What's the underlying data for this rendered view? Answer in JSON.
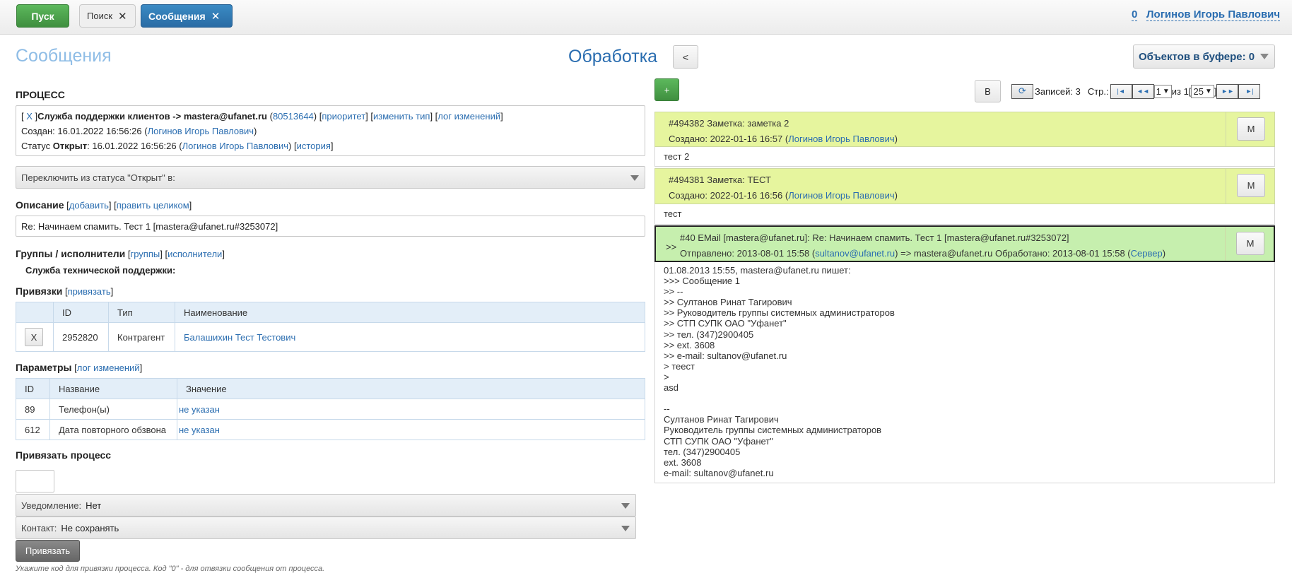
{
  "topbar": {
    "start_label": "Пуск",
    "tabs": [
      {
        "label": "Поиск",
        "close": "✕"
      },
      {
        "label": "Сообщения",
        "close": "✕"
      }
    ],
    "count": "0",
    "user": "Логинов Игорь Павлович"
  },
  "header": {
    "messages_title": "Сообщения",
    "processing_title": "Обработка",
    "back_label": "<",
    "buffer_label": "Объектов в буфере: 0"
  },
  "process": {
    "section_title": "ПРОЦЕСС",
    "line1": {
      "open": "[ ",
      "x": "X",
      "close": " ]",
      "name": "Служба поддержки клиентов -> mastera@ufanet.ru",
      "id_open": " (",
      "id": "80513644",
      "id_close": ") [",
      "priority": "приоритет",
      "sep1": "] [",
      "change_type": "изменить тип",
      "sep2": "] [",
      "change_log": "лог изменений",
      "end": "]"
    },
    "line2": {
      "prefix": "Создан: 16.01.2022 16:56:26 (",
      "user": "Логинов Игорь Павлович",
      "suffix": ")"
    },
    "line3": {
      "prefix": "Статус ",
      "status": "Открыт",
      "mid": ": 16.01.2022 16:56:26 (",
      "user": "Логинов Игорь Павлович",
      "mid2": ") [",
      "history": "история",
      "end": "]"
    },
    "switch_status": "Переключить из статуса \"Открыт\" в:"
  },
  "description": {
    "title": "Описание",
    "open1": " [",
    "add": "добавить",
    "sep": "] [",
    "edit_all": "править целиком",
    "end": "]",
    "value": "Re: Начинаем спамить. Тест 1 [mastera@ufanet.ru#3253072]"
  },
  "groups": {
    "title": "Группы / исполнители",
    "open1": " [",
    "groups_link": "группы",
    "sep": "] [",
    "executors_link": "исполнители",
    "end": "]",
    "group_name": "Служба технической поддержки:"
  },
  "links": {
    "title": "Привязки",
    "open1": " [",
    "bind_link": "привязать",
    "end": "]",
    "columns": [
      "",
      "ID",
      "Тип",
      "Наименование"
    ],
    "rows": [
      {
        "btn": "X",
        "id": "2952820",
        "type": "Контрагент",
        "name": "Балашихин Тест Тестович"
      }
    ]
  },
  "params": {
    "title": "Параметры",
    "open1": " [",
    "log_link": "лог изменений",
    "end": "]",
    "columns": [
      "ID",
      "Название",
      "Значение"
    ],
    "rows": [
      {
        "id": "89",
        "name": "Телефон(ы)",
        "value": "не указан"
      },
      {
        "id": "612",
        "name": "Дата повторного обзвона",
        "value": "не указан"
      }
    ]
  },
  "bind_process": {
    "title": "Привязать процесс",
    "notify_label": "Уведомление:",
    "notify_value": "Нет",
    "contact_label": "Контакт:",
    "contact_value": "Не сохранять",
    "bind_button": "Привязать",
    "hint": "Укажите код для привязки процесса. Код \"0\" - для отвязки сообщения от процесса."
  },
  "right_toolbar": {
    "plus_label": "+",
    "b_label": "B",
    "records_label": "Записей: 3",
    "page_label": "Стр.:",
    "page_value": "1",
    "of_label": "из 1",
    "page_size": "25",
    "bracket_open": "[",
    "bracket_close": "]",
    "first_icon": "|◄",
    "prev_icon": "◄◄",
    "next_icon": "►►",
    "last_icon": "►|",
    "refresh_icon": "⟳"
  },
  "messages": [
    {
      "title": "#494382 Заметка: заметка 2",
      "created_prefix": "Создано: 2022-01-16 16:57 (",
      "created_user": "Логинов Игорь Павлович",
      "created_suffix": ")",
      "m_label": "M",
      "body": "тест 2"
    },
    {
      "title": "#494381 Заметка: ТЕСТ",
      "created_prefix": "Создано: 2022-01-16 16:56 (",
      "created_user": "Логинов Игорь Павлович",
      "created_suffix": ")",
      "m_label": "M",
      "body": "тест"
    }
  ],
  "email": {
    "arrow": ">>",
    "title": "#40 EMail [mastera@ufanet.ru]: Re: Начинаем спамить. Тест 1 [mastera@ufanet.ru#3253072]",
    "sent_prefix": "Отправлено: 2013-08-01 15:58 (",
    "sent_from": "sultanov@ufanet.ru",
    "sent_mid": ") => mastera@ufanet.ru Обработано: 2013-08-01 15:58 (",
    "server": "Сервер",
    "sent_end": ")",
    "m_label": "M",
    "body_lines": [
      "01.08.2013 15:55, mastera@ufanet.ru пишет:",
      ">>> Сообщение 1",
      ">> --",
      ">> Султанов Ринат Тагирович",
      ">> Руководитель группы системных администраторов",
      ">> СТП СУПК ОАО \"Уфанет\"",
      ">> тел. (347)2900405",
      ">> ext. 3608",
      ">> e-mail: sultanov@ufanet.ru",
      "> теест",
      ">",
      "asd",
      " ",
      "--",
      "Султанов Ринат Тагирович",
      "Руководитель группы системных администраторов",
      "СТП СУПК ОАО \"Уфанет\"",
      "тел. (347)2900405",
      "ext. 3608",
      "e-mail: sultanov@ufanet.ru"
    ]
  }
}
